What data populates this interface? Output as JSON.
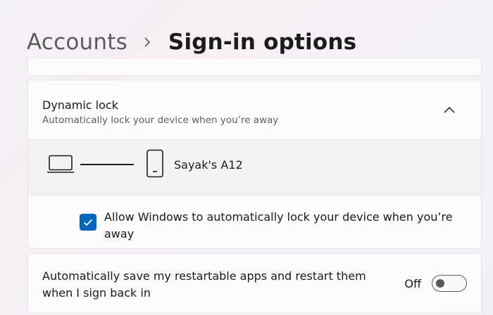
{
  "breadcrumb": {
    "parent": "Accounts",
    "current": "Sign-in options",
    "separator_icon": "chevron-right-icon"
  },
  "dynamic_lock": {
    "title": "Dynamic lock",
    "subtitle": "Automatically lock your device when you’re away",
    "expanded": true,
    "device_name": "Sayak's A12",
    "checkbox_label": "Allow Windows to automatically lock your device when you’re away",
    "checkbox_checked": true
  },
  "restart_apps": {
    "label": "Automatically save my restartable apps and restart them when I sign back in",
    "state_label": "Off",
    "enabled": false
  },
  "colors": {
    "accent": "#0067c0"
  }
}
